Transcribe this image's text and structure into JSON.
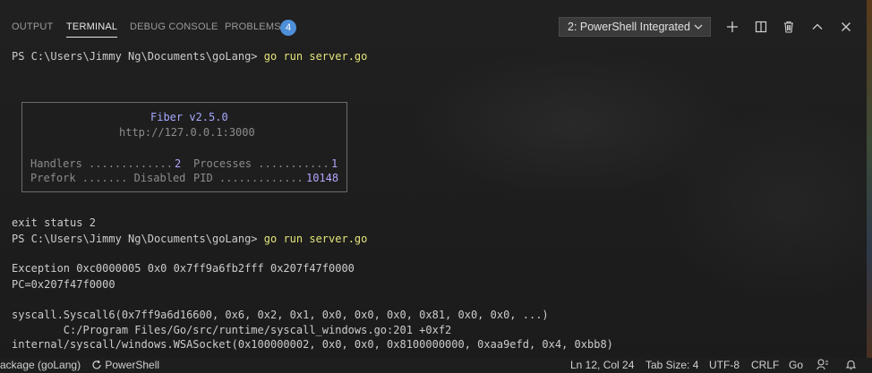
{
  "panel": {
    "tabs": [
      {
        "label": "OUTPUT"
      },
      {
        "label": "TERMINAL"
      },
      {
        "label": "DEBUG CONSOLE"
      },
      {
        "label": "PROBLEMS"
      }
    ],
    "problems_count": "4",
    "terminal_selector": "2: PowerShell Integrated"
  },
  "terminal": {
    "prompt1": "PS C:\\Users\\Jimmy Ng\\Documents\\goLang>",
    "cmd1": " go run server.go",
    "fiber": {
      "title": "Fiber v2.5.0",
      "url": "http://127.0.0.1:3000",
      "handlers_label": "Handlers .............",
      "handlers_value": "2",
      "processes_label": "Processes ...........",
      "processes_value": "1",
      "prefork_label": "Prefork ....... Disabled",
      "pid_label": "PID .............",
      "pid_value": "10148"
    },
    "exit_status": "exit status 2",
    "prompt2": "PS C:\\Users\\Jimmy Ng\\Documents\\goLang>",
    "cmd2": " go run server.go",
    "exception": "Exception 0xc0000005 0x0 0x7ff9a6fb2fff 0x207f47f0000",
    "pc": "PC=0x207f47f0000",
    "syscall": "syscall.Syscall6(0x7ff9a6d16600, 0x6, 0x2, 0x1, 0x0, 0x0, 0x0, 0x81, 0x0, 0x0, ...)",
    "syscall_path": "        C:/Program Files/Go/src/runtime/syscall_windows.go:201 +0xf2",
    "wsasocket": "internal/syscall/windows.WSASocket(0x100000002, 0x0, 0x0, 0x8100000000, 0xaa9efd, 0x4, 0xbb8)"
  },
  "statusbar": {
    "package": "ackage (goLang)",
    "shell": "PowerShell",
    "position": "Ln 12, Col 24",
    "tab_size": "Tab Size: 4",
    "encoding": "UTF-8",
    "eol": "CRLF",
    "language": "Go"
  }
}
